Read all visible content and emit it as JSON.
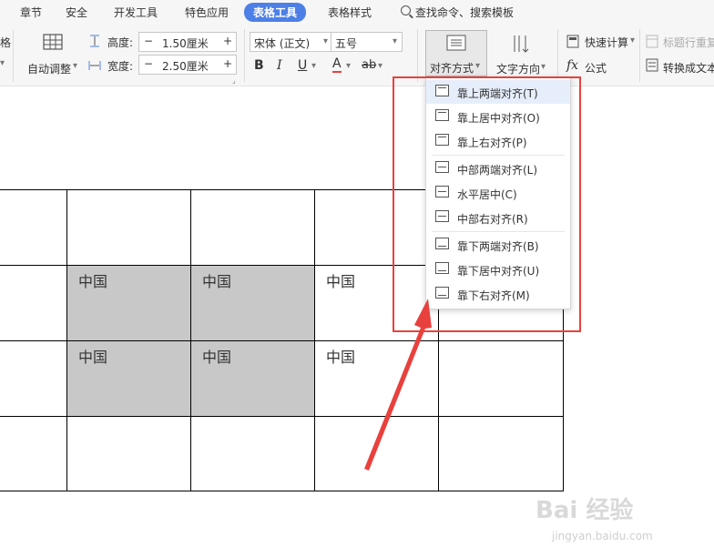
{
  "tabs": [
    "章节",
    "安全",
    "开发工具",
    "特色应用",
    "表格工具",
    "表格样式"
  ],
  "active_tab": "表格工具",
  "search": {
    "label": "查找命令、搜索模板"
  },
  "ribbon": {
    "left_clip": "格",
    "auto_fit": "自动调整",
    "height_label": "高度:",
    "height_value": "1.50厘米",
    "width_label": "宽度:",
    "width_value": "2.50厘米",
    "minus": "−",
    "plus": "+",
    "font_name": "宋体 (正文)",
    "font_size": "五号",
    "bold": "B",
    "italic": "I",
    "underline": "U",
    "font_color": "A",
    "highlight": "ab",
    "align_button": "对齐方式",
    "text_direction": "文字方向",
    "quick_calc": "快速计算",
    "formula": "公式",
    "title_row_repeat": "标题行重复",
    "convert_to_text": "转换成文本"
  },
  "table": {
    "cell_text": "中国",
    "accent_gray": "#c8c8c8"
  },
  "align_menu": {
    "items": [
      {
        "label": "靠上两端对齐(T)",
        "icon": "align-top-justify-icon"
      },
      {
        "label": "靠上居中对齐(O)",
        "icon": "align-top-center-icon"
      },
      {
        "label": "靠上右对齐(P)",
        "icon": "align-top-right-icon"
      },
      {
        "label": "中部两端对齐(L)",
        "icon": "align-middle-justify-icon"
      },
      {
        "label": "水平居中(C)",
        "icon": "align-middle-center-icon"
      },
      {
        "label": "中部右对齐(R)",
        "icon": "align-middle-right-icon"
      },
      {
        "label": "靠下两端对齐(B)",
        "icon": "align-bottom-justify-icon"
      },
      {
        "label": "靠下居中对齐(U)",
        "icon": "align-bottom-center-icon"
      },
      {
        "label": "靠下右对齐(M)",
        "icon": "align-bottom-right-icon"
      }
    ]
  },
  "annotation_color": "#e8413d",
  "watermark": {
    "brand": "Bai 经验",
    "url": "jingyan.baidu.com"
  }
}
